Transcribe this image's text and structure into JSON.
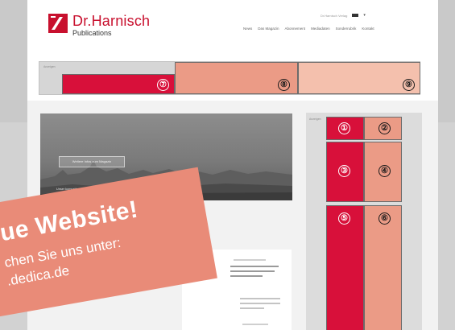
{
  "brand": {
    "name": "Dr.Harnisch",
    "sub": "Publications",
    "accent": "#c8102e"
  },
  "topbar": {
    "meta_text": "Dr.Harnisch Verlag"
  },
  "nav": {
    "items": [
      "News",
      "Das Magazin",
      "Abonnement",
      "Mediadaten",
      "Sonderrubrik",
      "Kontakt"
    ]
  },
  "ads": {
    "label": "Anzeigen",
    "sidebar_label": "Anzeigen",
    "slots": [
      "①",
      "②",
      "③",
      "④",
      "⑤",
      "⑥",
      "⑦",
      "⑧",
      "⑨"
    ],
    "colors": {
      "primary": "#d8103a",
      "mid": "#eb9b86",
      "light": "#f4c0ad"
    }
  },
  "hero": {
    "button_label": "Weitere Infos zum Magazin",
    "caption": "Unser kompakter Überblick über die aktuellsten Meldungen"
  },
  "banner": {
    "title": "eue Website!",
    "line1": "chen Sie uns unter:",
    "line2": ".dedica.de",
    "color": "#e98b78"
  }
}
